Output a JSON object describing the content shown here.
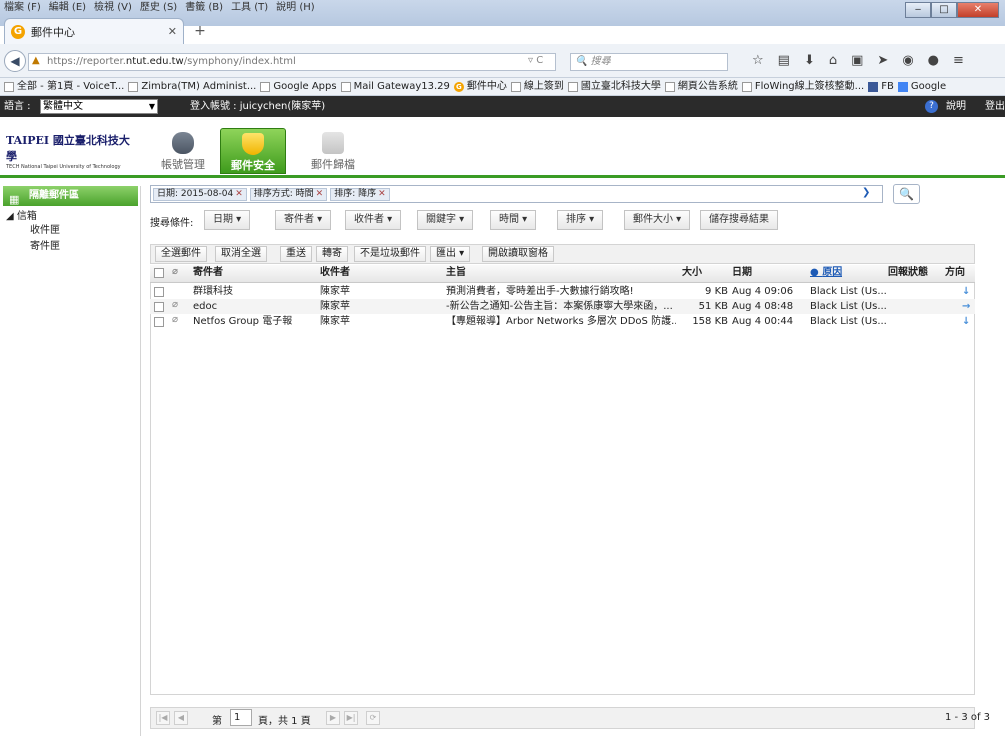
{
  "browser": {
    "menu": [
      "檔案 (F)",
      "編輯 (E)",
      "檢視 (V)",
      "歷史 (S)",
      "書籤 (B)",
      "工具 (T)",
      "說明 (H)"
    ],
    "tab_title": "郵件中心",
    "url_prefix": "https://reporter.",
    "url_host": "ntut.edu.tw",
    "url_path": "/symphony/index.html",
    "search_placeholder": "搜尋",
    "bookmarks": [
      "全部 - 第1頁 - VoiceT...",
      "Zimbra(TM) Administ...",
      "Google Apps",
      "Mail Gateway13.29",
      "郵件中心",
      "線上簽到",
      "國立臺北科技大學",
      "網頁公告系統",
      "FloWing線上簽核整動...",
      "FB",
      "Google"
    ]
  },
  "header": {
    "language_label": "語言 :",
    "language_value": "繁體中文",
    "login_label": "登入帳號 : juicychen(陳家苹)",
    "help_label": "說明",
    "logout_label": "登出"
  },
  "logo": {
    "brand": "TAIPEI 國立臺北科技大學",
    "sub": "TECH National Taipei University of Technology"
  },
  "app_tabs": [
    {
      "label": "帳號管理"
    },
    {
      "label": "郵件安全"
    },
    {
      "label": "郵件歸檔"
    }
  ],
  "sidebar": {
    "title": "隔離郵件區",
    "root": "信箱",
    "items": [
      "收件匣",
      "寄件匣"
    ]
  },
  "filters": [
    "日期: 2015-08-04",
    "排序方式: 時間",
    "排序: 降序"
  ],
  "search_conditions": {
    "label": "搜尋條件:",
    "buttons": [
      "日期 ▾",
      "寄件者 ▾",
      "收件者 ▾",
      "關鍵字 ▾",
      "時間 ▾",
      "排序 ▾",
      "郵件大小 ▾",
      "儲存搜尋結果"
    ]
  },
  "toolbar": [
    "全選郵件",
    "取消全選",
    "重送",
    "轉寄",
    "不是垃圾郵件",
    "匯出 ▾",
    "開啟讀取窗格"
  ],
  "table": {
    "columns": [
      "寄件者",
      "收件者",
      "主旨",
      "大小",
      "日期",
      "原因",
      "回報狀態",
      "方向"
    ],
    "rows": [
      {
        "sender": "群環科技",
        "recipient": "陳家苹",
        "subject": "預測消費者，零時差出手-大數據行銷攻略!",
        "size": "9 KB",
        "date": "Aug 4 09:06",
        "reason": "Black List (Us...",
        "status": "",
        "direction": "↓",
        "attach": false
      },
      {
        "sender": "edoc",
        "recipient": "陳家苹",
        "subject": "-新公告之通知-公告主旨：本案係康寧大學來函，...",
        "size": "51 KB",
        "date": "Aug 4 08:48",
        "reason": "Black List (Us...",
        "status": "",
        "direction": "→",
        "attach": true
      },
      {
        "sender": "Netfos Group 電子報",
        "recipient": "陳家苹",
        "subject": "【專題報導】Arbor Networks 多層次 DDoS 防護...",
        "size": "158 KB",
        "date": "Aug 4 00:44",
        "reason": "Black List (Us...",
        "status": "",
        "direction": "↓",
        "attach": true
      }
    ]
  },
  "pager": {
    "page_label": "第",
    "page_value": "1",
    "total_label": "頁，共 1 頁",
    "range": "1 - 3 of 3"
  },
  "colors": {
    "accent_green": "#3a9b24",
    "link_blue": "#1d5ab5"
  }
}
